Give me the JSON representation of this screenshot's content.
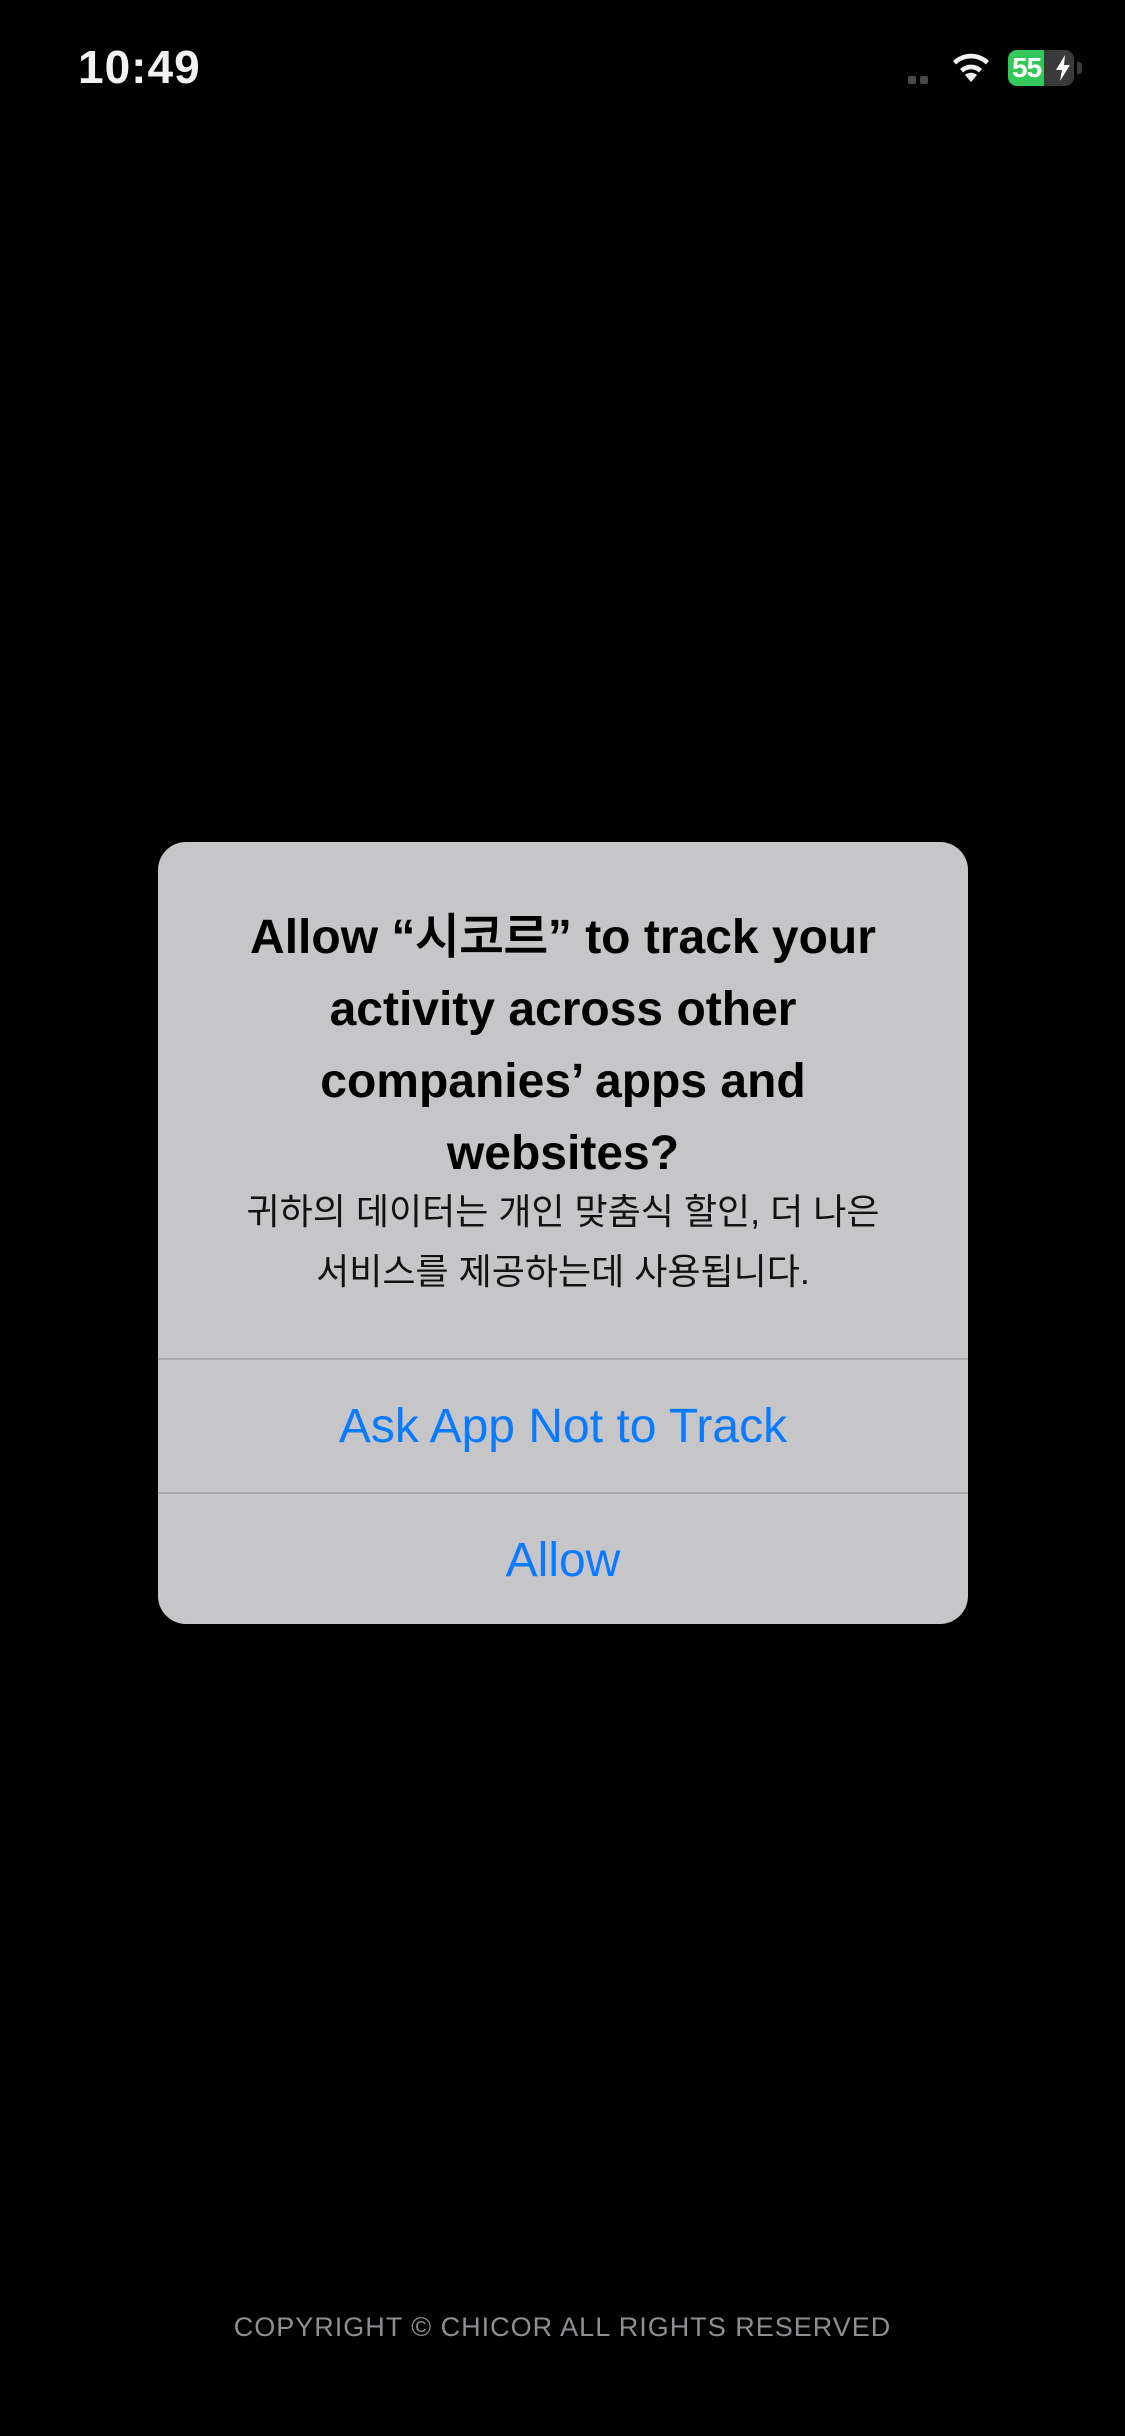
{
  "status_bar": {
    "time": "10:49",
    "battery_percent": "55",
    "battery_level": 0.55,
    "icons": [
      "cellular-signal-icon",
      "wifi-icon",
      "battery-icon",
      "charging-bolt-icon"
    ]
  },
  "alert": {
    "title": "Allow “시코르” to track your\nactivity across other\ncompanies’ apps and\nwebsites?",
    "message": "귀하의 데이터는 개인 맞춤식 할인, 더 나은\n서비스를 제공하는데 사용됩니다.",
    "buttons": [
      {
        "label": "Ask App Not to Track"
      },
      {
        "label": "Allow"
      }
    ]
  },
  "footer": {
    "copyright": "COPYRIGHT © CHICOR ALL RIGHTS RESERVED"
  },
  "colors": {
    "background": "#000000",
    "alert_background": "#c6c6c8",
    "button_text": "#0a7aff",
    "battery_fill": "#34c759"
  }
}
